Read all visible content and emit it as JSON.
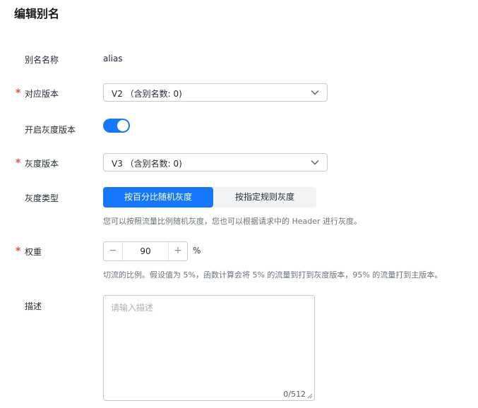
{
  "page": {
    "title": "编辑别名"
  },
  "form": {
    "alias_name": {
      "label": "别名名称",
      "value": "alias"
    },
    "version": {
      "label": "对应版本",
      "value": "V2 （含别名数: 0)"
    },
    "gray_enable": {
      "label": "开启灰度版本",
      "enabled": true
    },
    "gray_version": {
      "label": "灰度版本",
      "value": "V3 （含别名数: 0)"
    },
    "gray_type": {
      "label": "灰度类型",
      "options": [
        "按百分比随机灰度",
        "按指定规则灰度"
      ],
      "selected": "按百分比随机灰度",
      "hint": "您可以按照流量比例随机灰度，您也可以根据请求中的 Header 进行灰度。"
    },
    "weight": {
      "label": "权重",
      "value": "90",
      "unit": "%",
      "minus": "−",
      "plus": "+",
      "hint": "切流的比例。假设值为 5%，函数计算会将 5% 的流量到打到灰度版本，95% 的流量打到主版本。"
    },
    "description": {
      "label": "描述",
      "placeholder": "请输入描述",
      "counter": "0/512"
    },
    "required_mark": "*"
  },
  "colors": {
    "primary": "#1677ff",
    "required": "#e6513c"
  }
}
